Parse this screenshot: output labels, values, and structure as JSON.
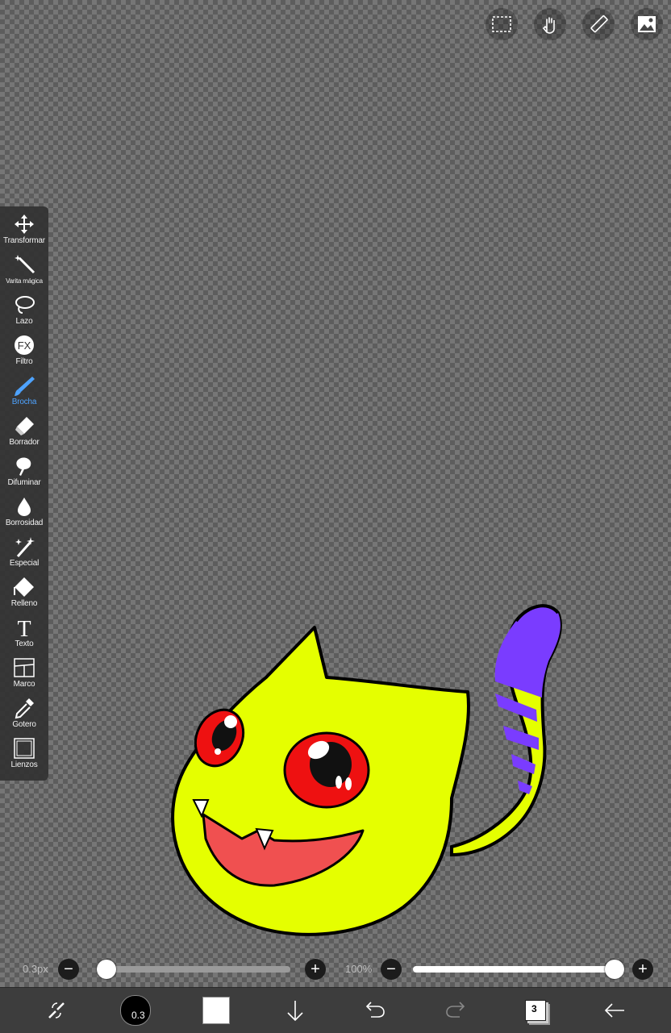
{
  "top_bar": {
    "icons": [
      "selection-icon",
      "hand-gesture-icon",
      "ruler-pencil-icon",
      "image-icon"
    ]
  },
  "tools": [
    {
      "icon": "move-arrows-icon",
      "label": "Transformar"
    },
    {
      "icon": "magic-wand-icon",
      "label": "Varita mágica"
    },
    {
      "icon": "lasso-icon",
      "label": "Lazo"
    },
    {
      "icon": "fx-icon",
      "label": "Filtro"
    },
    {
      "icon": "brush-icon",
      "label": "Brocha",
      "active": true
    },
    {
      "icon": "eraser-icon",
      "label": "Borrador"
    },
    {
      "icon": "smudge-icon",
      "label": "Difuminar"
    },
    {
      "icon": "blur-drop-icon",
      "label": "Borrosidad"
    },
    {
      "icon": "sparkle-icon",
      "label": "Especial"
    },
    {
      "icon": "fill-bucket-icon",
      "label": "Relleno"
    },
    {
      "icon": "text-icon",
      "label": "Texto"
    },
    {
      "icon": "frame-icon",
      "label": "Marco"
    },
    {
      "icon": "eyedropper-icon",
      "label": "Gotero"
    },
    {
      "icon": "canvas-icon",
      "label": "Lienzos"
    }
  ],
  "sliders": {
    "size_value": "0.3px",
    "size_fraction": 0.0,
    "opacity_value": "100%",
    "opacity_fraction": 1.0,
    "minus": "−",
    "plus": "+"
  },
  "bottom_bar": {
    "brush_size": "0.3",
    "color": "#ffffff",
    "layer_count": "3",
    "icons": [
      "swap-tools-icon",
      "brush-size-icon",
      "color-icon",
      "download-icon",
      "undo-icon",
      "redo-icon",
      "layers-icon",
      "back-icon"
    ]
  },
  "colors": {
    "accent": "#4ea3ff",
    "cat_body": "#e5ff00",
    "eye": "#ee1111",
    "mouth": "#f05050",
    "tail_stripe": "#7a3cff"
  }
}
